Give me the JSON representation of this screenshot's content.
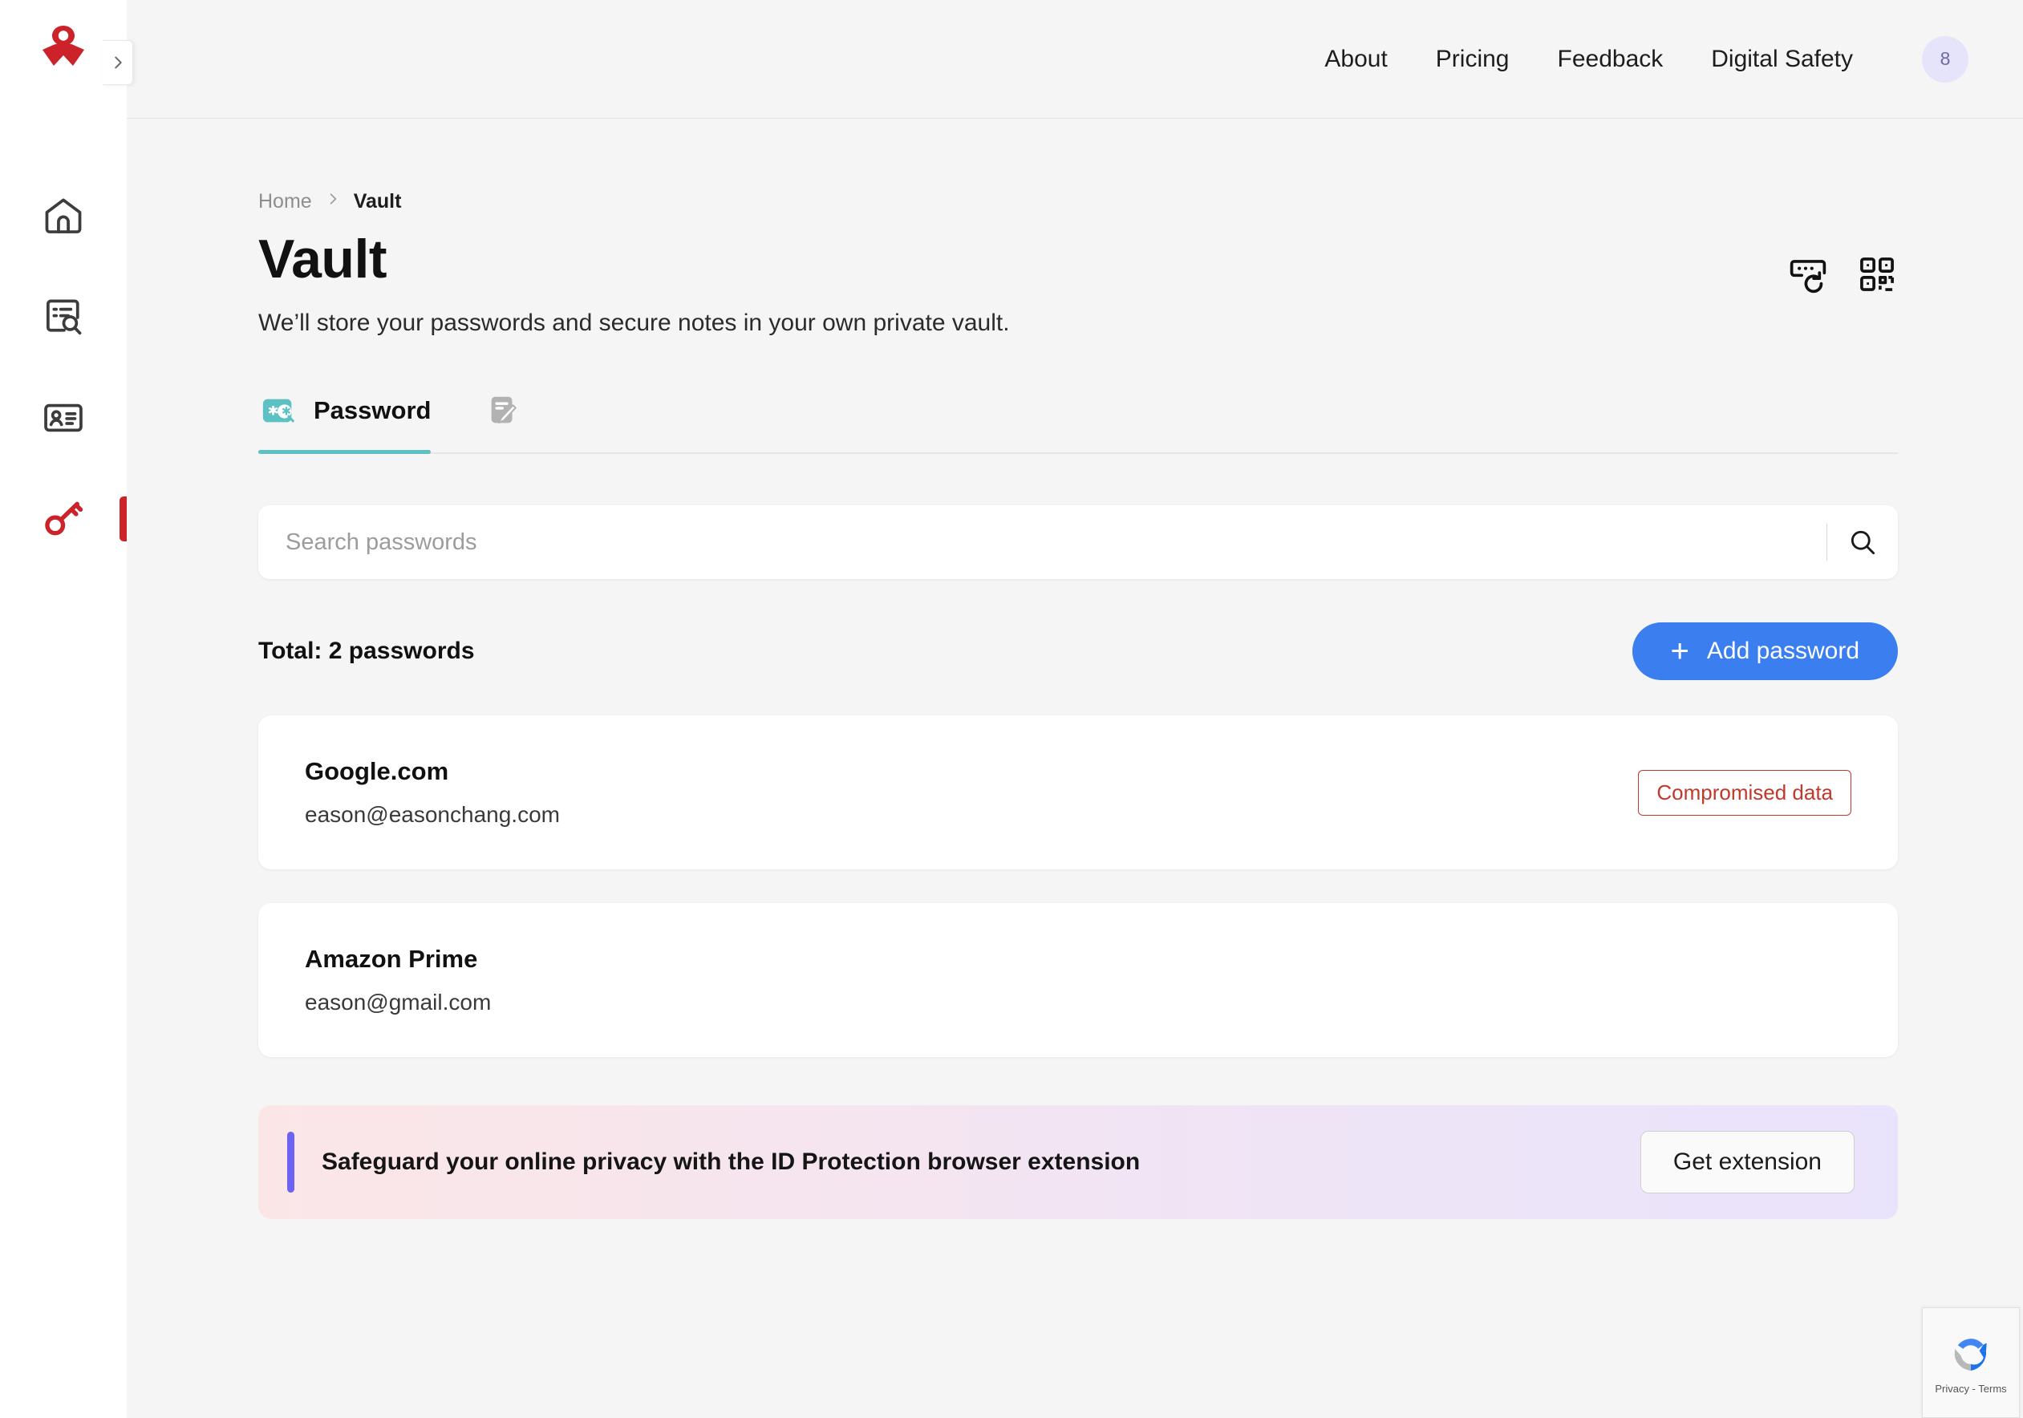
{
  "sidebar": {
    "logo_icon": "avira-logo-icon",
    "collapse_icon": "chevron-right-icon",
    "items": [
      {
        "name": "home",
        "icon": "home-icon",
        "active": false
      },
      {
        "name": "scan",
        "icon": "document-search-icon",
        "active": false
      },
      {
        "name": "identity",
        "icon": "id-card-icon",
        "active": false
      },
      {
        "name": "vault",
        "icon": "key-icon",
        "active": true
      }
    ]
  },
  "topbar": {
    "nav": [
      {
        "label": "About"
      },
      {
        "label": "Pricing"
      },
      {
        "label": "Feedback"
      },
      {
        "label": "Digital Safety"
      }
    ],
    "avatar_initial": "8"
  },
  "breadcrumb": {
    "home": "Home",
    "separator": "›",
    "current": "Vault"
  },
  "page": {
    "title": "Vault",
    "subtitle": "We’ll store your passwords and secure notes in your own private vault.",
    "actions": [
      {
        "icon": "password-generator-icon"
      },
      {
        "icon": "qr-code-icon"
      }
    ]
  },
  "tabs": [
    {
      "label": "Password",
      "icon": "password-asterisk-icon",
      "active": true
    },
    {
      "label": "",
      "icon": "secure-note-icon",
      "active": false
    }
  ],
  "search": {
    "placeholder": "Search passwords",
    "value": "",
    "icon": "search-icon"
  },
  "list": {
    "total_label": "Total: 2 passwords",
    "add_label": "Add password",
    "add_icon": "plus-icon",
    "entries": [
      {
        "title": "Google.com",
        "username": "eason@easonchang.com",
        "badge": "Compromised data"
      },
      {
        "title": "Amazon Prime",
        "username": "eason@gmail.com",
        "badge": ""
      }
    ]
  },
  "banner": {
    "text": "Safeguard your online privacy with the ID Protection browser extension",
    "button_label": "Get extension"
  },
  "recaptcha": {
    "icon": "recaptcha-icon",
    "terms": "Privacy - Terms"
  },
  "colors": {
    "brand_red": "#cc2229",
    "accent_teal": "#5dc1c4",
    "primary_blue": "#3b7ef0",
    "danger_red": "#c0392b",
    "banner_accent": "#6c63f5",
    "avatar_bg": "#e6e4fb",
    "page_bg": "#f5f5f5",
    "card_bg": "#ffffff"
  }
}
